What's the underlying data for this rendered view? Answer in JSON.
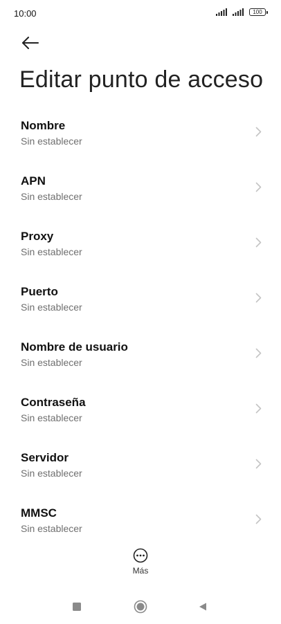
{
  "status_bar": {
    "time": "10:00",
    "battery_level": "100",
    "icons": [
      "signal-icon",
      "signal-icon",
      "battery-icon"
    ]
  },
  "header": {
    "back_icon": "back-arrow-icon",
    "title": "Editar punto de acceso"
  },
  "items": [
    {
      "title": "Nombre",
      "subtitle": "Sin establecer"
    },
    {
      "title": "APN",
      "subtitle": "Sin establecer"
    },
    {
      "title": "Proxy",
      "subtitle": "Sin establecer"
    },
    {
      "title": "Puerto",
      "subtitle": "Sin establecer"
    },
    {
      "title": "Nombre de usuario",
      "subtitle": "Sin establecer"
    },
    {
      "title": "Contraseña",
      "subtitle": "Sin establecer"
    },
    {
      "title": "Servidor",
      "subtitle": "Sin establecer"
    },
    {
      "title": "MMSC",
      "subtitle": "Sin establecer"
    }
  ],
  "more": {
    "label": "Más",
    "icon": "more-dots-icon"
  },
  "nav_bar": {
    "icons": [
      "recents-square-icon",
      "home-circle-icon",
      "back-triangle-icon"
    ]
  },
  "colors": {
    "background": "#ffffff",
    "title_text": "#111111",
    "subtitle_text": "#6f6f6f",
    "chevron": "#c4c4c4",
    "nav_icons": "#8a8a8a"
  }
}
